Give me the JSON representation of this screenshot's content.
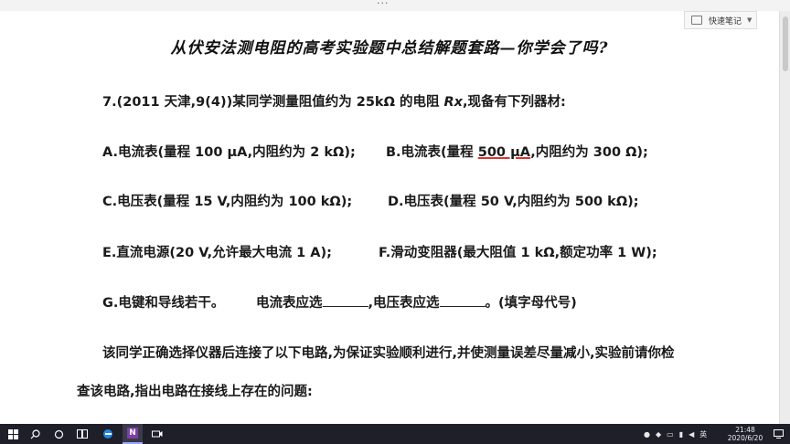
{
  "window": {
    "topbar_dots": "···"
  },
  "quick_note": {
    "label": "快速笔记"
  },
  "slide": {
    "title": "从伏安法测电阻的高考实验题中总结解题套路—你学会了吗?",
    "question_intro": "7.(2011 天津,9(4))某同学测量阻值约为 25kΩ 的电阻 ",
    "rx_symbol": "Rx",
    "question_intro_tail": ",现备有下列器材:",
    "options": {
      "A": "A.电流表(量程 100 μA,内阻约为  2 kΩ);",
      "B_pre": "B.电流表(量程 ",
      "B_ul": "500 μA",
      "B_post": ",内阻约为 300 Ω);",
      "C": "C.电压表(量程 15 V,内阻约为 100 kΩ);",
      "D": "D.电压表(量程 50 V,内阻约为 500 kΩ);",
      "E": "E.直流电源(20 V,允许最大电流 1 A);",
      "F": "F.滑动变阻器(最大阻值 1 kΩ,额定功率 1 W);",
      "G": "G.电键和导线若干。"
    },
    "fill_a": "电流表应选",
    "fill_b": ",电压表应选",
    "fill_c": "。(填字母代号)",
    "para1": "该同学正确选择仪器后连接了以下电路,为保证实验顺利进行,并使测量误差尽量减小,实验前请你检",
    "para2": "查该电路,指出电路在接线上存在的问题:"
  },
  "taskbar": {
    "apps": [
      "start-icon",
      "search-icon",
      "cortana-icon",
      "task-view-icon",
      "edge-icon",
      "onenote-icon",
      "camera-icon"
    ],
    "onenote_label": "N",
    "ime": "英",
    "time": "21:48",
    "date": "2020/6/20"
  },
  "colors": {
    "taskbar": "#1f1f2a",
    "accent_underline": "#dd3333",
    "text": "#111111"
  }
}
